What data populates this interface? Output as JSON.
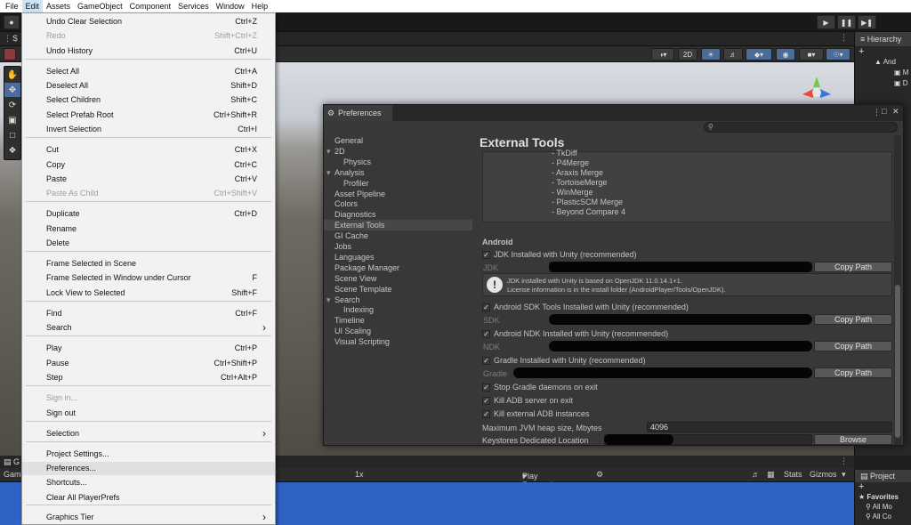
{
  "menubar": [
    "File",
    "Edit",
    "Assets",
    "GameObject",
    "Component",
    "Services",
    "Window",
    "Help"
  ],
  "scene_tab": "S",
  "game_tab_prefix": "G",
  "game_label": "Game",
  "hierarchy": {
    "title": "Hierarchy",
    "add": "+",
    "rows": [
      "And",
      "M",
      "D"
    ]
  },
  "game": {
    "scale": "1x",
    "play_mode": "Play Focused",
    "stats": "Stats",
    "gizmos": "Gizmos"
  },
  "scene_toolbar": {
    "mode2d": "2D"
  },
  "project": {
    "title": "Project",
    "add": "+",
    "favorites": "Favorites",
    "rows": [
      "All Mo",
      "All Co"
    ]
  },
  "edit_menu": {
    "items": [
      {
        "label": "Undo Clear Selection",
        "shortcut": "Ctrl+Z",
        "disabled": false
      },
      {
        "label": "Redo",
        "shortcut": "Shift+Ctrl+Z",
        "disabled": true
      },
      {
        "label": "Undo History",
        "shortcut": "Ctrl+U",
        "disabled": false
      },
      {
        "label": "Select All",
        "shortcut": "Ctrl+A",
        "disabled": false
      },
      {
        "label": "Deselect All",
        "shortcut": "Shift+D",
        "disabled": false
      },
      {
        "label": "Select Children",
        "shortcut": "Shift+C",
        "disabled": false
      },
      {
        "label": "Select Prefab Root",
        "shortcut": "Ctrl+Shift+R",
        "disabled": false
      },
      {
        "label": "Invert Selection",
        "shortcut": "Ctrl+I",
        "disabled": false
      },
      {
        "label": "Cut",
        "shortcut": "Ctrl+X",
        "disabled": false
      },
      {
        "label": "Copy",
        "shortcut": "Ctrl+C",
        "disabled": false
      },
      {
        "label": "Paste",
        "shortcut": "Ctrl+V",
        "disabled": false
      },
      {
        "label": "Paste As Child",
        "shortcut": "Ctrl+Shift+V",
        "disabled": true
      },
      {
        "label": "Duplicate",
        "shortcut": "Ctrl+D",
        "disabled": false
      },
      {
        "label": "Rename",
        "shortcut": "",
        "disabled": false
      },
      {
        "label": "Delete",
        "shortcut": "",
        "disabled": false
      },
      {
        "label": "Frame Selected in Scene",
        "shortcut": "",
        "disabled": false
      },
      {
        "label": "Frame Selected in Window under Cursor",
        "shortcut": "F",
        "disabled": false
      },
      {
        "label": "Lock View to Selected",
        "shortcut": "Shift+F",
        "disabled": false
      },
      {
        "label": "Find",
        "shortcut": "Ctrl+F",
        "disabled": false
      },
      {
        "label": "Search",
        "shortcut": "",
        "disabled": false,
        "submenu": true
      },
      {
        "label": "Play",
        "shortcut": "Ctrl+P",
        "disabled": false
      },
      {
        "label": "Pause",
        "shortcut": "Ctrl+Shift+P",
        "disabled": false
      },
      {
        "label": "Step",
        "shortcut": "Ctrl+Alt+P",
        "disabled": false
      },
      {
        "label": "Sign in...",
        "shortcut": "",
        "disabled": true
      },
      {
        "label": "Sign out",
        "shortcut": "",
        "disabled": false
      },
      {
        "label": "Selection",
        "shortcut": "",
        "disabled": false,
        "submenu": true
      },
      {
        "label": "Project Settings...",
        "shortcut": "",
        "disabled": false
      },
      {
        "label": "Preferences...",
        "shortcut": "",
        "disabled": false,
        "highlighted": true
      },
      {
        "label": "Shortcuts...",
        "shortcut": "",
        "disabled": false
      },
      {
        "label": "Clear All PlayerPrefs",
        "shortcut": "",
        "disabled": false
      },
      {
        "label": "Graphics Tier",
        "shortcut": "",
        "disabled": false,
        "submenu": true
      }
    ]
  },
  "preferences": {
    "title": "Preferences",
    "sidebar": [
      {
        "label": "General",
        "indent": 0
      },
      {
        "label": "2D",
        "indent": 0,
        "fold": true
      },
      {
        "label": "Physics",
        "indent": 2
      },
      {
        "label": "Analysis",
        "indent": 0,
        "fold": true
      },
      {
        "label": "Profiler",
        "indent": 2
      },
      {
        "label": "Asset Pipeline",
        "indent": 0
      },
      {
        "label": "Colors",
        "indent": 0
      },
      {
        "label": "Diagnostics",
        "indent": 0
      },
      {
        "label": "External Tools",
        "indent": 0,
        "selected": true
      },
      {
        "label": "GI Cache",
        "indent": 0
      },
      {
        "label": "Jobs",
        "indent": 0
      },
      {
        "label": "Languages",
        "indent": 0
      },
      {
        "label": "Package Manager",
        "indent": 0
      },
      {
        "label": "Scene View",
        "indent": 0
      },
      {
        "label": "Scene Template",
        "indent": 0
      },
      {
        "label": "Search",
        "indent": 0,
        "fold": true
      },
      {
        "label": "Indexing",
        "indent": 2
      },
      {
        "label": "Timeline",
        "indent": 0
      },
      {
        "label": "UI Scaling",
        "indent": 0
      },
      {
        "label": "Visual Scripting",
        "indent": 0
      }
    ],
    "heading": "External Tools",
    "merge_tools": [
      "- TkDiff",
      "- P4Merge",
      "- Araxis Merge",
      "- TortoiseMerge",
      "- WinMerge",
      "- PlasticSCM Merge",
      "- Beyond Compare 4"
    ],
    "android_label": "Android",
    "jdk_check": "JDK Installed with Unity (recommended)",
    "jdk_label": "JDK",
    "copy_path": "Copy Path",
    "jdk_info_1": "JDK installed with Unity is based on OpenJDK 11.0.14.1+1.",
    "jdk_info_2": "License information is in the install folder (AndroidPlayer/Tools/OpenJDK).",
    "sdk_check": "Android SDK Tools Installed with Unity (recommended)",
    "sdk_label": "SDK",
    "ndk_check": "Android NDK Installed with Unity (recommended)",
    "ndk_label": "NDK",
    "gradle_check": "Gradle Installed with Unity (recommended)",
    "gradle_label": "Gradle",
    "stop_gradle": "Stop Gradle daemons on exit",
    "kill_adb": "Kill ADB server on exit",
    "kill_ext_adb": "Kill external ADB instances",
    "jvm_label": "Maximum JVM heap size, Mbytes",
    "jvm_value": "4096",
    "keystores_label": "Keystores Dedicated Location",
    "browse": "Browse"
  }
}
